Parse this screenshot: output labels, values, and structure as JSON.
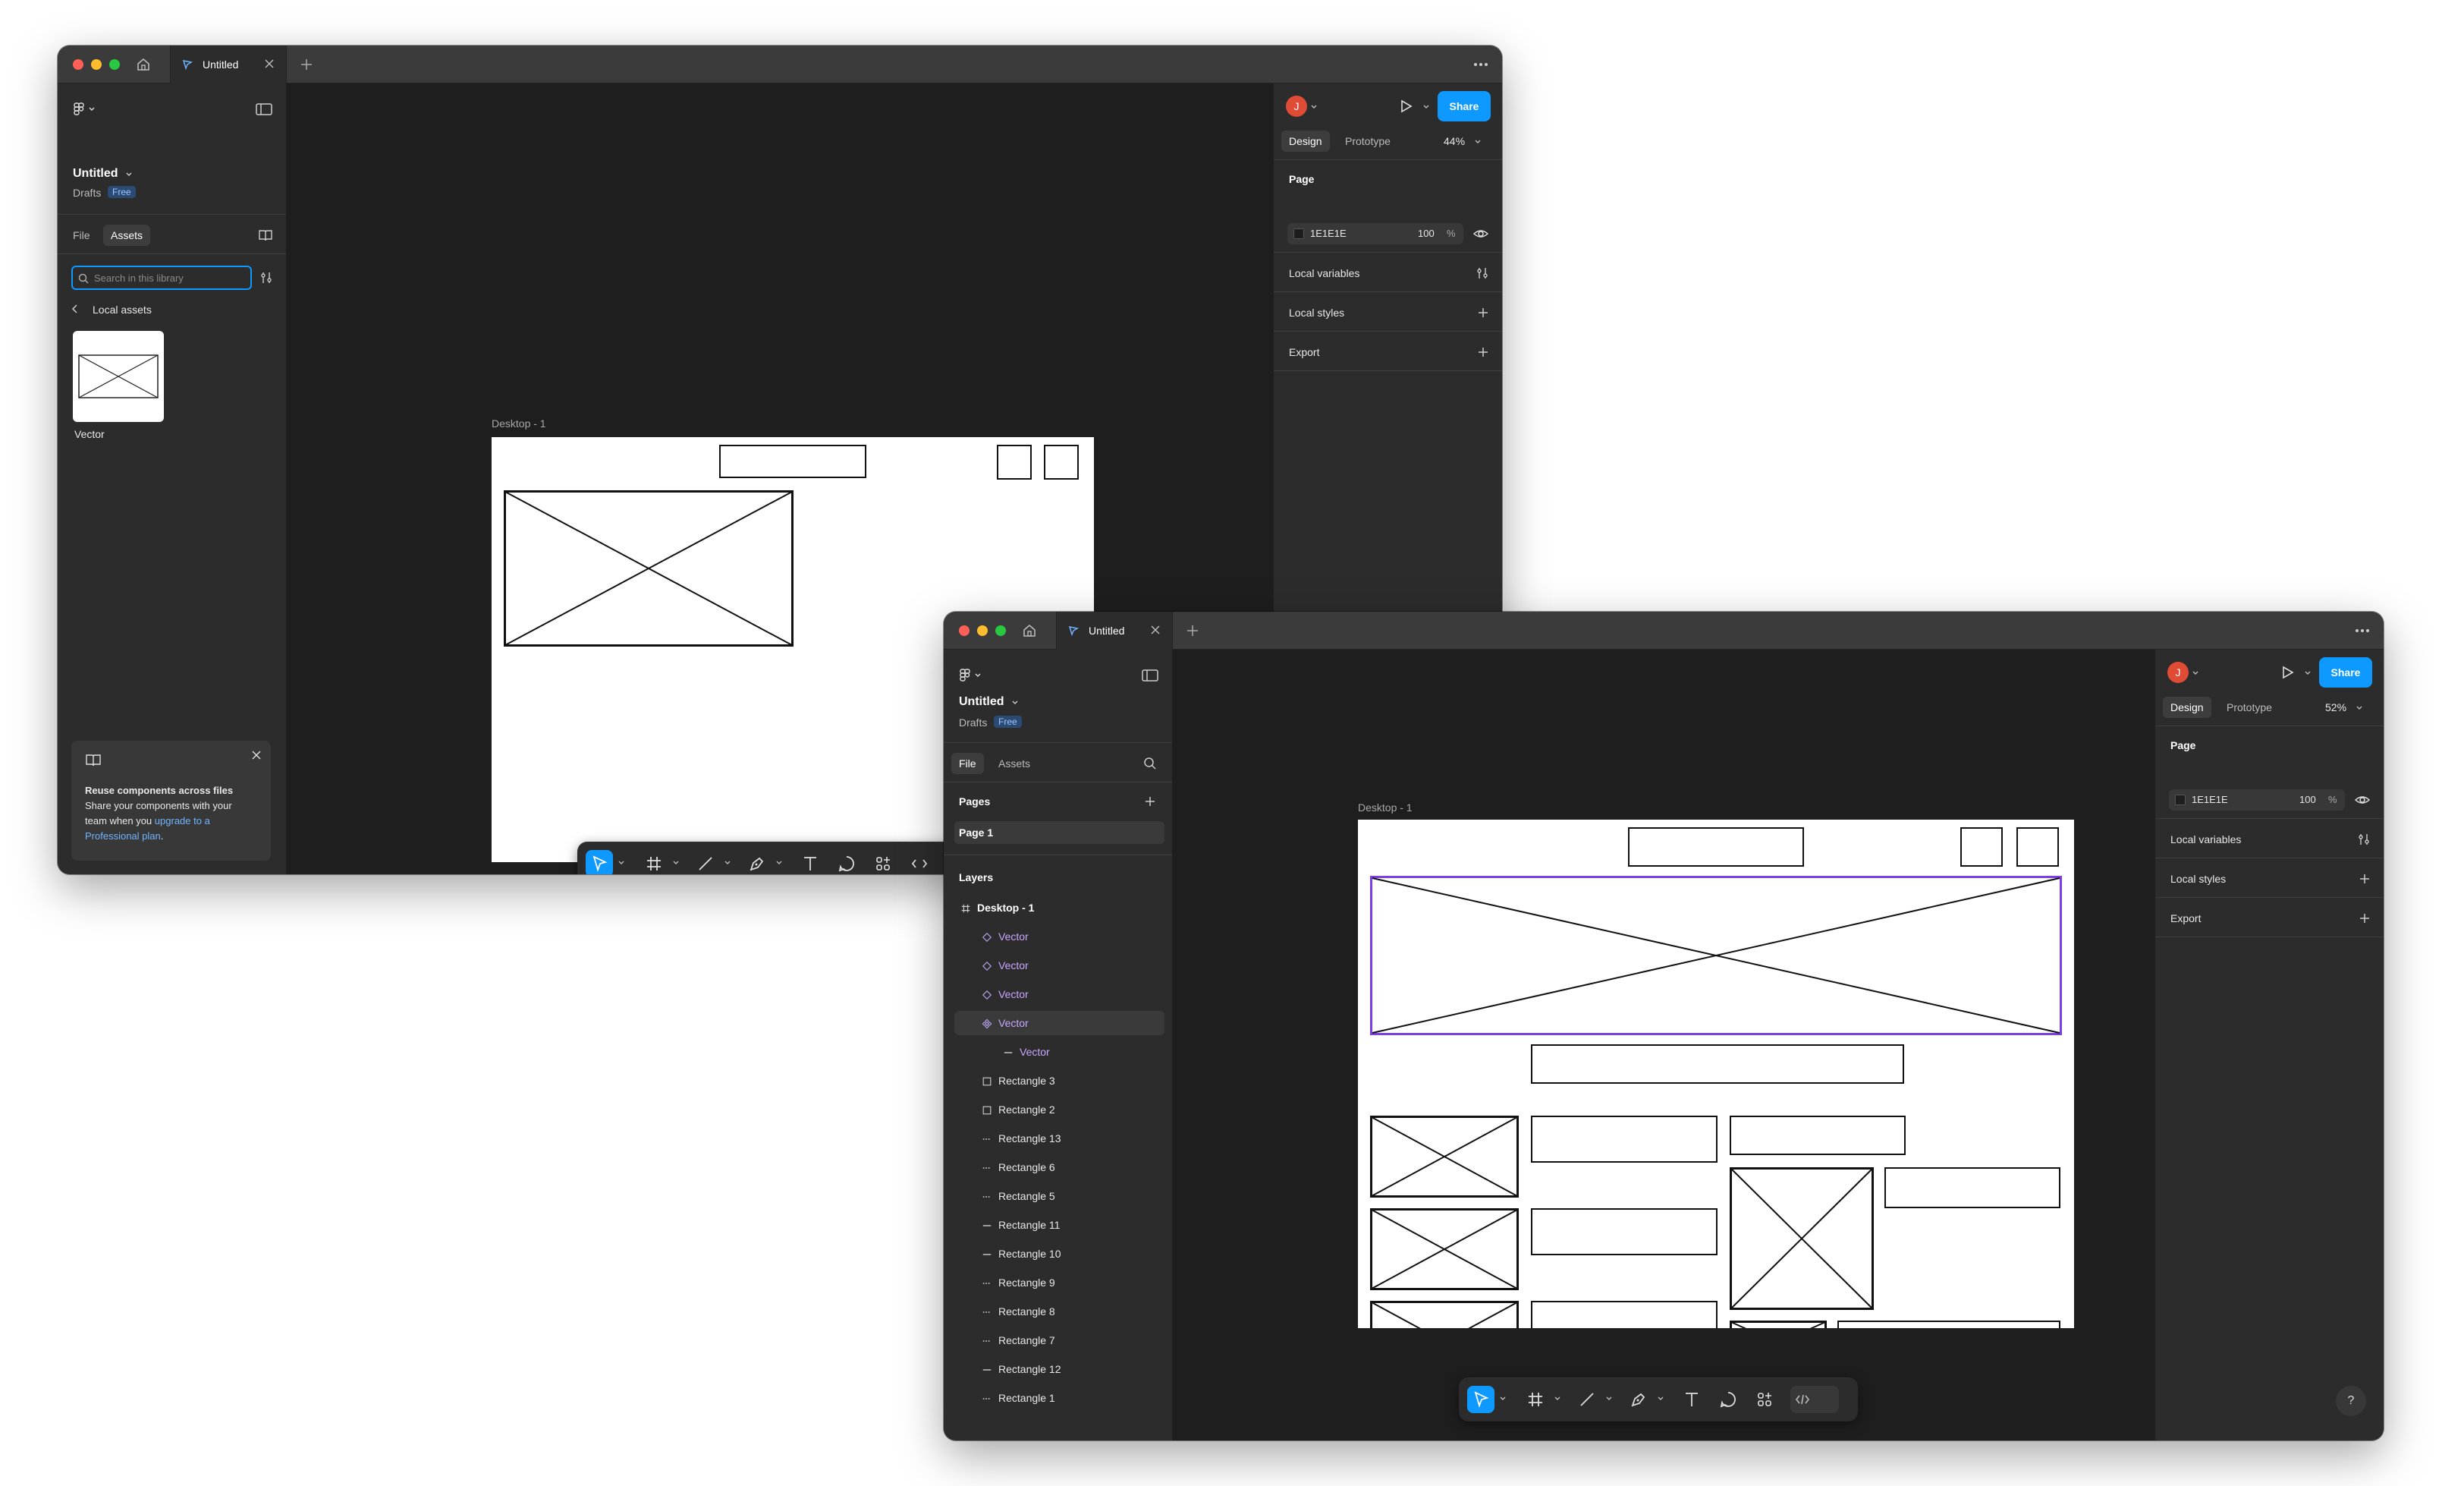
{
  "windows": [
    {
      "tab_title": "Untitled",
      "file": {
        "name": "Untitled",
        "location": "Drafts",
        "plan_badge": "Free"
      },
      "left_tabs": {
        "file": "File",
        "assets": "Assets",
        "active": "Assets"
      },
      "assets": {
        "search_placeholder": "Search in this library",
        "back_label": "Local assets",
        "items": [
          {
            "label": "Vector"
          }
        ]
      },
      "promo": {
        "title": "Reuse components across files",
        "body": "Share your components with your team when you",
        "link": "upgrade to a Professional plan",
        "period": "."
      },
      "right": {
        "tabs": {
          "design": "Design",
          "prototype": "Prototype"
        },
        "zoom": "44%",
        "share": "Share",
        "avatar_initial": "J",
        "page_heading": "Page",
        "page_color": "1E1E1E",
        "page_opacity": "100",
        "page_opacity_unit": "%",
        "sections": [
          "Local variables",
          "Local styles",
          "Export"
        ]
      },
      "canvas": {
        "frame_label": "Desktop - 1"
      }
    },
    {
      "tab_title": "Untitled",
      "file": {
        "name": "Untitled",
        "location": "Drafts",
        "plan_badge": "Free"
      },
      "left_tabs": {
        "file": "File",
        "assets": "Assets",
        "active": "File"
      },
      "pages": {
        "heading": "Pages",
        "items": [
          "Page 1"
        ]
      },
      "layers": {
        "heading": "Layers",
        "items": [
          {
            "label": "Desktop - 1",
            "icon": "frame-icon",
            "indent": 0
          },
          {
            "label": "Vector",
            "icon": "component-instance-icon",
            "indent": 1
          },
          {
            "label": "Vector",
            "icon": "component-instance-icon",
            "indent": 1
          },
          {
            "label": "Vector",
            "icon": "component-instance-icon",
            "indent": 1
          },
          {
            "label": "Vector",
            "icon": "component-main-icon",
            "indent": 1
          },
          {
            "label": "Vector",
            "icon": "line-icon",
            "indent": 2
          },
          {
            "label": "Rectangle 3",
            "icon": "rectangle-icon",
            "indent": 1
          },
          {
            "label": "Rectangle 2",
            "icon": "rectangle-icon",
            "indent": 1
          },
          {
            "label": "Rectangle 13",
            "icon": "dashed-line-icon",
            "indent": 1
          },
          {
            "label": "Rectangle 6",
            "icon": "dashed-line-icon",
            "indent": 1
          },
          {
            "label": "Rectangle 5",
            "icon": "dashed-line-icon",
            "indent": 1
          },
          {
            "label": "Rectangle 11",
            "icon": "line-icon",
            "indent": 1
          },
          {
            "label": "Rectangle 10",
            "icon": "line-icon",
            "indent": 1
          },
          {
            "label": "Rectangle 9",
            "icon": "dashed-line-icon",
            "indent": 1
          },
          {
            "label": "Rectangle 8",
            "icon": "dashed-line-icon",
            "indent": 1
          },
          {
            "label": "Rectangle 7",
            "icon": "dashed-line-icon",
            "indent": 1
          },
          {
            "label": "Rectangle 12",
            "icon": "line-icon",
            "indent": 1
          },
          {
            "label": "Rectangle 1",
            "icon": "dashed-line-icon",
            "indent": 1
          }
        ]
      },
      "right": {
        "tabs": {
          "design": "Design",
          "prototype": "Prototype"
        },
        "zoom": "52%",
        "share": "Share",
        "avatar_initial": "J",
        "page_heading": "Page",
        "page_color": "1E1E1E",
        "page_opacity": "100",
        "page_opacity_unit": "%",
        "sections": [
          "Local variables",
          "Local styles",
          "Export"
        ]
      },
      "canvas": {
        "frame_label": "Desktop - 1"
      },
      "help_label": "?"
    }
  ],
  "colors": {
    "accent": "#0d99ff",
    "selection": "#7b3fe4",
    "panel": "#2c2c2c",
    "canvas": "#1e1e1e"
  }
}
